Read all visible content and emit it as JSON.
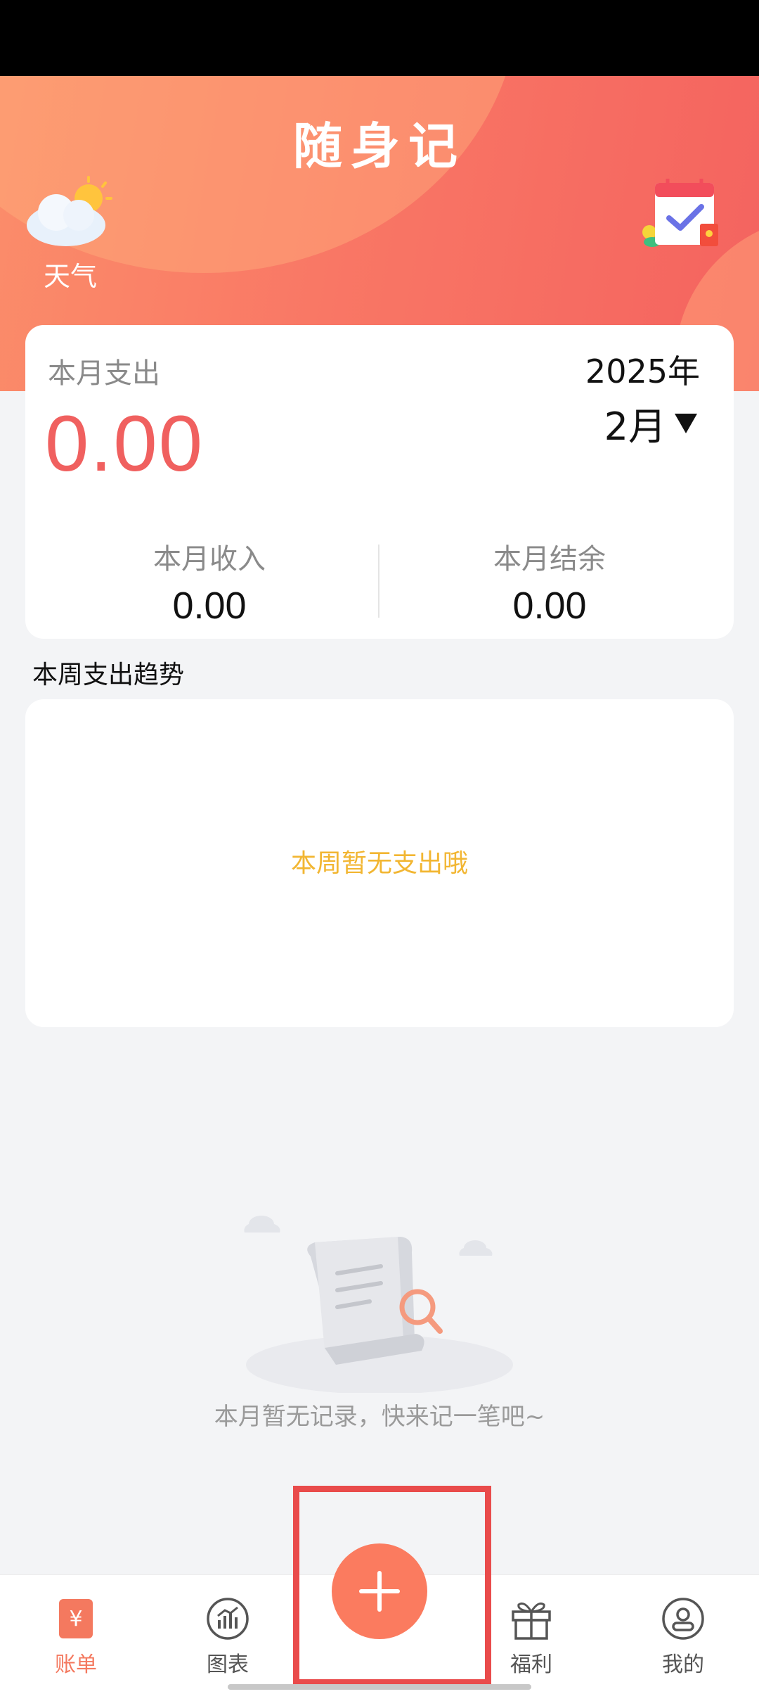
{
  "app": {
    "title": "随身记"
  },
  "header": {
    "weather_label": "天气"
  },
  "summary": {
    "expense_label": "本月支出",
    "expense_value": "0.00",
    "year": "2025年",
    "month": "2月",
    "income_label": "本月收入",
    "income_value": "0.00",
    "balance_label": "本月结余",
    "balance_value": "0.00"
  },
  "weekly": {
    "title": "本周支出趋势",
    "empty_text": "本周暂无支出哦"
  },
  "records": {
    "empty_text": "本月暂无记录，快来记一笔吧~"
  },
  "tabbar": {
    "items": [
      {
        "label": "账单",
        "icon": "bill-icon",
        "active": true
      },
      {
        "label": "图表",
        "icon": "chart-icon",
        "active": false
      },
      {
        "label": "福利",
        "icon": "gift-icon",
        "active": false
      },
      {
        "label": "我的",
        "icon": "profile-icon",
        "active": false
      }
    ],
    "add_icon": "plus-icon"
  },
  "colors": {
    "accent": "#f4795f",
    "expense": "#f0605f",
    "empty_week": "#f2b632",
    "highlight": "#e94b4b"
  }
}
